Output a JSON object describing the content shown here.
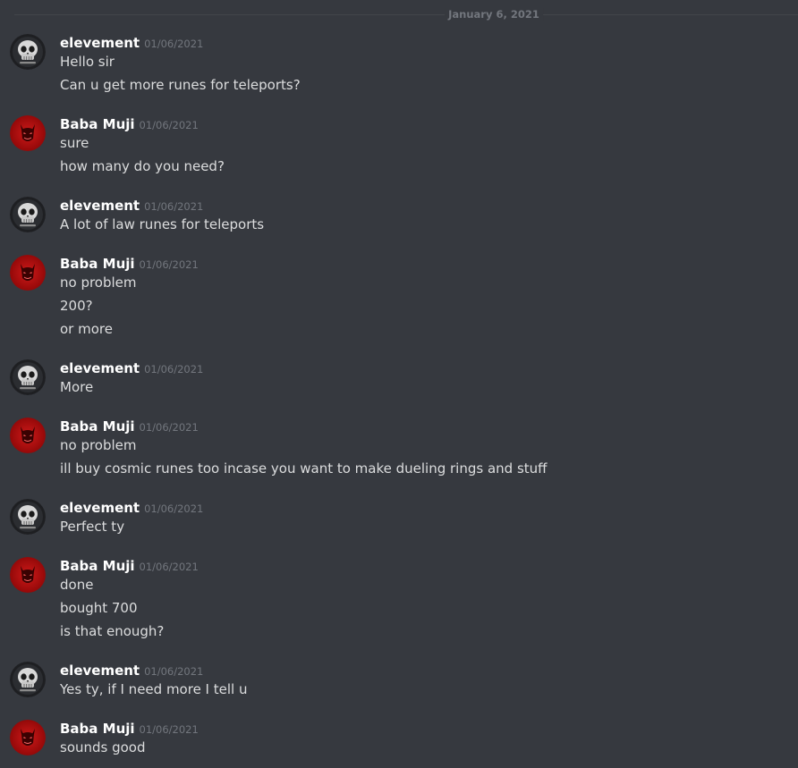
{
  "date_divider": "January 6, 2021",
  "colors": {
    "background": "#36393f",
    "username": "#ffffff",
    "text": "#dcddde",
    "muted": "#72767d",
    "avatar_red": "#b30d0d",
    "avatar_dark": "#1e1f22"
  },
  "messages": [
    {
      "user": "elevement",
      "avatar": "skull-avatar-icon",
      "time": "01/06/2021",
      "lines": [
        "Hello sir",
        "Can u get more runes for teleports?"
      ]
    },
    {
      "user": "Baba Muji",
      "avatar": "red-demon-avatar-icon",
      "time": "01/06/2021",
      "lines": [
        "sure",
        "how many do you need?"
      ]
    },
    {
      "user": "elevement",
      "avatar": "skull-avatar-icon",
      "time": "01/06/2021",
      "lines": [
        "A lot of law runes for teleports"
      ]
    },
    {
      "user": "Baba Muji",
      "avatar": "red-demon-avatar-icon",
      "time": "01/06/2021",
      "lines": [
        "no problem",
        "200?",
        "or more"
      ]
    },
    {
      "user": "elevement",
      "avatar": "skull-avatar-icon",
      "time": "01/06/2021",
      "lines": [
        "More"
      ]
    },
    {
      "user": "Baba Muji",
      "avatar": "red-demon-avatar-icon",
      "time": "01/06/2021",
      "lines": [
        "no problem",
        "ill buy cosmic runes too incase you want to make dueling rings and stuff"
      ]
    },
    {
      "user": "elevement",
      "avatar": "skull-avatar-icon",
      "time": "01/06/2021",
      "lines": [
        "Perfect ty"
      ]
    },
    {
      "user": "Baba Muji",
      "avatar": "red-demon-avatar-icon",
      "time": "01/06/2021",
      "lines": [
        "done",
        "bought 700",
        "is that enough?"
      ]
    },
    {
      "user": "elevement",
      "avatar": "skull-avatar-icon",
      "time": "01/06/2021",
      "lines": [
        "Yes ty, if I need more I tell u"
      ]
    },
    {
      "user": "Baba Muji",
      "avatar": "red-demon-avatar-icon",
      "time": "01/06/2021",
      "lines": [
        "sounds good"
      ]
    }
  ]
}
